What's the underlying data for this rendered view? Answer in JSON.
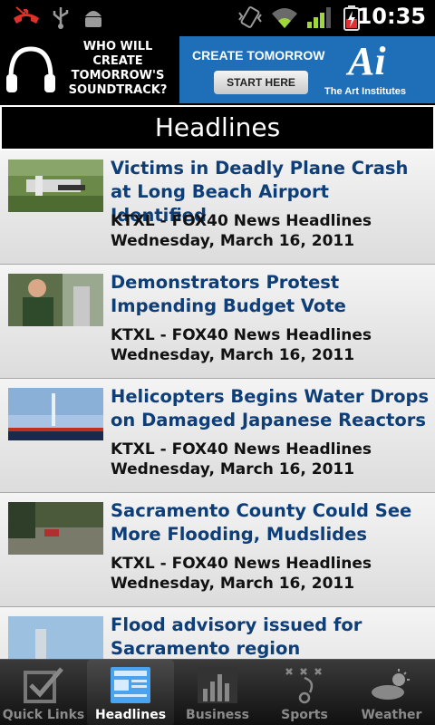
{
  "status_bar": {
    "time": "10:35",
    "icons": [
      "missed-call-icon",
      "usb-icon",
      "android-debug-icon",
      "vibrate-icon",
      "wifi-icon",
      "signal-icon",
      "battery-charging-icon"
    ]
  },
  "ad": {
    "left_text": "WHO WILL CREATE TOMORROW'S SOUNDTRACK?",
    "create_text": "CREATE TOMORROW",
    "start_button": "START HERE",
    "logo_text": "Ai",
    "brand_text": "The Art Institutes"
  },
  "header": {
    "title": "Headlines"
  },
  "headlines": [
    {
      "title": "Victims in Deadly Plane Crash at Long Beach Airport Identified",
      "source": "KTXL - FOX40 News Headlines",
      "date": "Wednesday, March 16, 2011",
      "thumb": "plane-crash-thumbnail"
    },
    {
      "title": "Demonstrators Protest Impending Budget Vote",
      "source": "KTXL - FOX40 News Headlines",
      "date": "Wednesday, March 16, 2011",
      "thumb": "protest-thumbnail"
    },
    {
      "title": "Helicopters Begins Water Drops on Damaged Japanese Reactors",
      "source": "KTXL - FOX40 News Headlines",
      "date": "Wednesday, March 16, 2011",
      "thumb": "helicopter-thumbnail"
    },
    {
      "title": "Sacramento County Could See More Flooding, Mudslides",
      "source": "KTXL - FOX40 News Headlines",
      "date": "Wednesday, March 16, 2011",
      "thumb": "flooding-thumbnail"
    },
    {
      "title": "Flood advisory issued for Sacramento region",
      "source": "",
      "date": "",
      "thumb": "flood-advisory-thumbnail"
    }
  ],
  "tabs": [
    {
      "label": "Quick Links",
      "icon": "checkbox-icon"
    },
    {
      "label": "Headlines",
      "icon": "newspaper-icon"
    },
    {
      "label": "Business",
      "icon": "bar-chart-icon"
    },
    {
      "label": "Sports",
      "icon": "playbook-icon"
    },
    {
      "label": "Weather",
      "icon": "cloud-sun-icon"
    }
  ],
  "colors": {
    "headline": "#0e3e78",
    "ad_blue": "#1f6fb8",
    "active_tab_icon": "#4aa3f0"
  }
}
